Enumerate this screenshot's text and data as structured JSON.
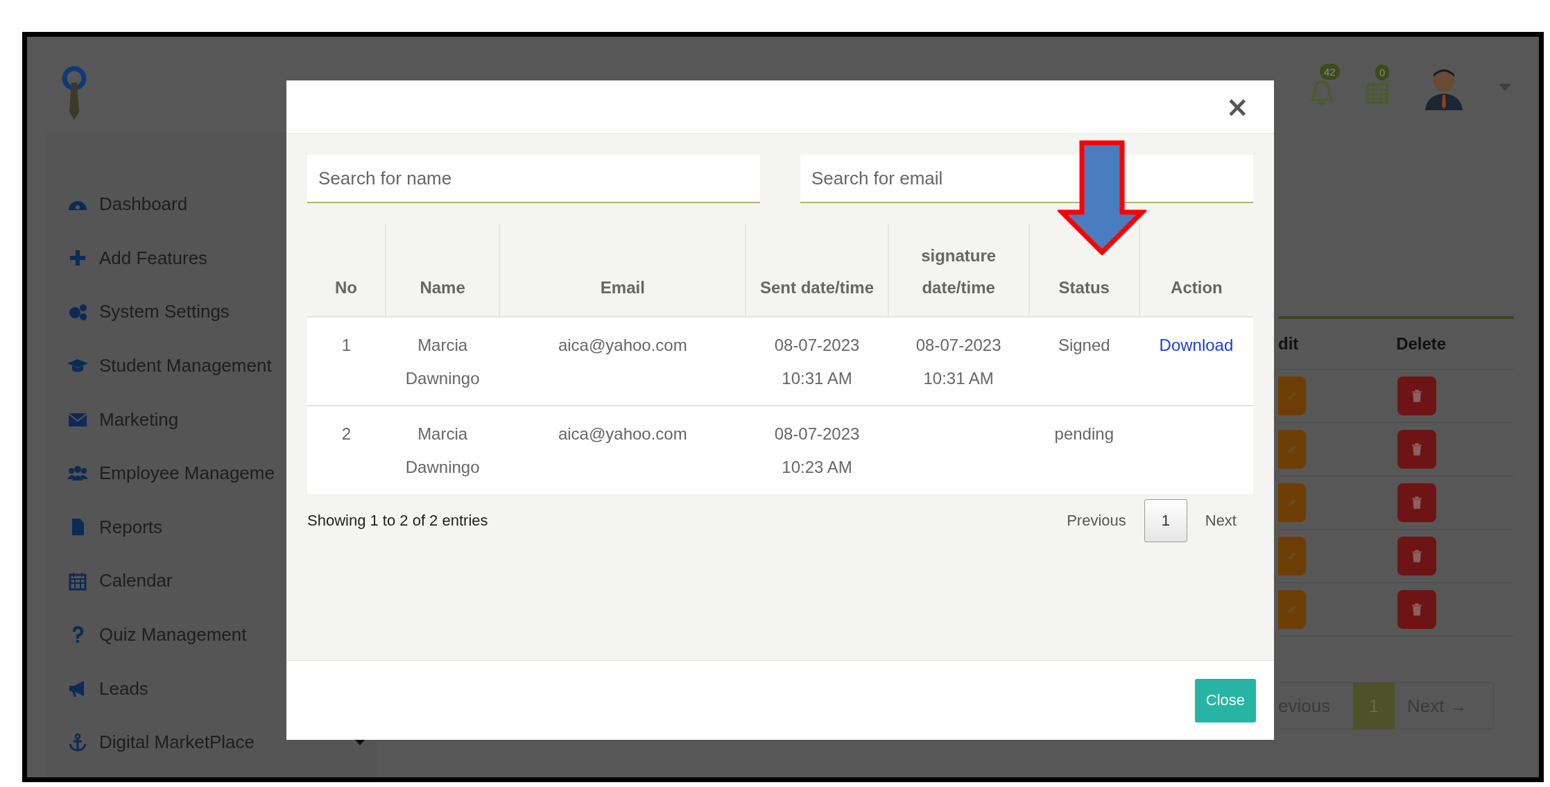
{
  "header": {
    "notification_badge": "42",
    "calendar_badge": "0"
  },
  "sidebar": {
    "items": [
      {
        "label": "Dashboard",
        "kind": "link"
      },
      {
        "label": "Add Features",
        "kind": "link"
      },
      {
        "label": "System Settings",
        "kind": "link"
      },
      {
        "label": "Student Management",
        "kind": "link"
      },
      {
        "label": "Marketing",
        "kind": "link"
      },
      {
        "label": "Employee Manageme",
        "kind": "link"
      },
      {
        "label": "Reports",
        "kind": "link"
      },
      {
        "label": "Calendar",
        "kind": "link"
      },
      {
        "label": "Quiz Management",
        "kind": "link"
      },
      {
        "label": "Leads",
        "kind": "link"
      },
      {
        "label": "Digital MarketPlace",
        "kind": "dropdown"
      }
    ]
  },
  "background_table": {
    "columns": [
      "dit",
      "Delete"
    ],
    "rows": [
      {
        "kind": "edit-delete"
      },
      {
        "kind": "edit-delete"
      },
      {
        "kind": "edit-delete"
      },
      {
        "kind": "edit-delete"
      },
      {
        "kind": "edit-delete"
      }
    ],
    "pagination": {
      "previous": "evious",
      "pages": [
        {
          "label": "1",
          "selected": true
        }
      ],
      "next": "Next →"
    }
  },
  "modal": {
    "close": "×",
    "search_name": {
      "placeholder": "Search for name"
    },
    "search_email": {
      "placeholder": "Search for email"
    },
    "table": {
      "columns": [
        "No",
        "Name",
        "Email",
        "Sent date/time",
        "signature date/time",
        "Status",
        "Action"
      ],
      "rows": [
        {
          "no": "1",
          "name": "Marcia Dawningo",
          "email": "aica@yahoo.com",
          "sent": "08-07-2023\n10:31 AM",
          "signature": "08-07-2023\n10:31 AM",
          "status": "Signed",
          "action": "Download"
        },
        {
          "no": "2",
          "name": "Marcia Dawningo",
          "email": "aica@yahoo.com",
          "sent": "08-07-2023\n10:23 AM",
          "status": "pending"
        }
      ]
    },
    "info": "Showing 1 to 2 of 2 entries",
    "pagination": {
      "previous": "Previous",
      "pages": [
        {
          "label": "1",
          "selected": true
        }
      ],
      "next": "Next"
    },
    "footer_button": "Close"
  }
}
